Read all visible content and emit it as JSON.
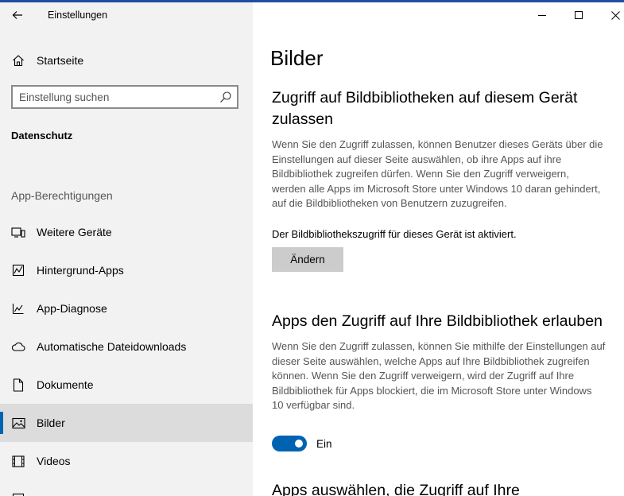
{
  "window": {
    "title": "Einstellungen",
    "accent_color": "#0063b1"
  },
  "sidebar": {
    "home_label": "Startseite",
    "search_placeholder": "Einstellung suchen",
    "section_title": "Datenschutz",
    "group_title": "App-Berechtigungen",
    "items": [
      {
        "label": "Weitere Geräte",
        "icon": "devices-icon"
      },
      {
        "label": "Hintergrund-Apps",
        "icon": "background-apps-icon"
      },
      {
        "label": "App-Diagnose",
        "icon": "diagnostics-icon"
      },
      {
        "label": "Automatische Dateidownloads",
        "icon": "cloud-icon"
      },
      {
        "label": "Dokumente",
        "icon": "document-icon"
      },
      {
        "label": "Bilder",
        "icon": "picture-icon",
        "selected": true
      },
      {
        "label": "Videos",
        "icon": "video-icon"
      }
    ]
  },
  "main": {
    "page_title": "Bilder",
    "section1": {
      "heading": "Zugriff auf Bildbibliotheken auf diesem Gerät zulassen",
      "description": "Wenn Sie den Zugriff zulassen, können Benutzer dieses Geräts über die Einstellungen auf dieser Seite auswählen, ob ihre Apps auf ihre Bildbibliothek zugreifen dürfen. Wenn Sie den Zugriff verweigern, werden alle Apps im Microsoft Store unter Windows 10 daran gehindert, auf die Bildbibliotheken von Benutzern zuzugreifen.",
      "status": "Der Bildbibliothekszugriff für dieses Gerät ist aktiviert.",
      "button_label": "Ändern"
    },
    "section2": {
      "heading": "Apps den Zugriff auf Ihre Bildbibliothek erlauben",
      "description": "Wenn Sie den Zugriff zulassen, können Sie mithilfe der Einstellungen auf dieser Seite auswählen, welche Apps auf Ihre Bildbibliothek zugreifen können. Wenn Sie den Zugriff verweigern, wird der Zugriff auf Ihre Bildbibliothek für Apps blockiert, die im Microsoft Store unter Windows 10 verfügbar sind.",
      "toggle_state": "on",
      "toggle_label": "Ein"
    },
    "section3": {
      "heading": "Apps auswählen, die Zugriff auf Ihre"
    }
  }
}
